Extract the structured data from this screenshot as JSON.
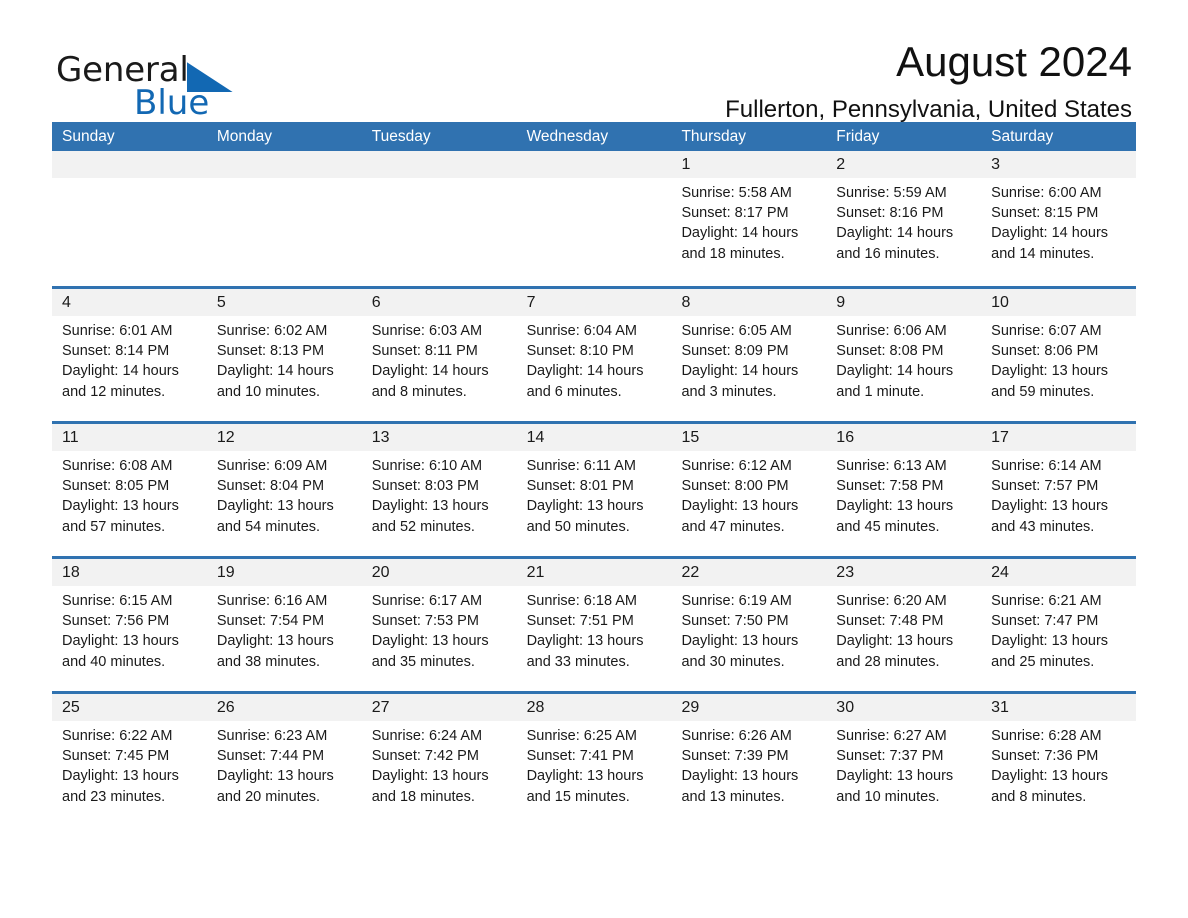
{
  "brand": {
    "name_part1": "General",
    "name_part2": "Blue",
    "accent_color": "#1268b3",
    "triangle_icon": "triangle-icon"
  },
  "header": {
    "title": "August 2024",
    "subtitle": "Fullerton, Pennsylvania, United States"
  },
  "theme": {
    "header_row_bg": "#3072b0",
    "header_row_text": "#ffffff",
    "daynum_band_bg": "#f2f2f2",
    "row_divider": "#3072b0",
    "body_text": "#1a1a1a",
    "page_bg": "#ffffff"
  },
  "calendar": {
    "weekday_headers": [
      "Sunday",
      "Monday",
      "Tuesday",
      "Wednesday",
      "Thursday",
      "Friday",
      "Saturday"
    ],
    "weeks": [
      {
        "days": [
          {
            "date": "",
            "sunrise": "",
            "sunset": "",
            "daylight_line1": "",
            "daylight_line2": ""
          },
          {
            "date": "",
            "sunrise": "",
            "sunset": "",
            "daylight_line1": "",
            "daylight_line2": ""
          },
          {
            "date": "",
            "sunrise": "",
            "sunset": "",
            "daylight_line1": "",
            "daylight_line2": ""
          },
          {
            "date": "",
            "sunrise": "",
            "sunset": "",
            "daylight_line1": "",
            "daylight_line2": ""
          },
          {
            "date": "1",
            "sunrise": "Sunrise: 5:58 AM",
            "sunset": "Sunset: 8:17 PM",
            "daylight_line1": "Daylight: 14 hours",
            "daylight_line2": "and 18 minutes."
          },
          {
            "date": "2",
            "sunrise": "Sunrise: 5:59 AM",
            "sunset": "Sunset: 8:16 PM",
            "daylight_line1": "Daylight: 14 hours",
            "daylight_line2": "and 16 minutes."
          },
          {
            "date": "3",
            "sunrise": "Sunrise: 6:00 AM",
            "sunset": "Sunset: 8:15 PM",
            "daylight_line1": "Daylight: 14 hours",
            "daylight_line2": "and 14 minutes."
          }
        ]
      },
      {
        "days": [
          {
            "date": "4",
            "sunrise": "Sunrise: 6:01 AM",
            "sunset": "Sunset: 8:14 PM",
            "daylight_line1": "Daylight: 14 hours",
            "daylight_line2": "and 12 minutes."
          },
          {
            "date": "5",
            "sunrise": "Sunrise: 6:02 AM",
            "sunset": "Sunset: 8:13 PM",
            "daylight_line1": "Daylight: 14 hours",
            "daylight_line2": "and 10 minutes."
          },
          {
            "date": "6",
            "sunrise": "Sunrise: 6:03 AM",
            "sunset": "Sunset: 8:11 PM",
            "daylight_line1": "Daylight: 14 hours",
            "daylight_line2": "and 8 minutes."
          },
          {
            "date": "7",
            "sunrise": "Sunrise: 6:04 AM",
            "sunset": "Sunset: 8:10 PM",
            "daylight_line1": "Daylight: 14 hours",
            "daylight_line2": "and 6 minutes."
          },
          {
            "date": "8",
            "sunrise": "Sunrise: 6:05 AM",
            "sunset": "Sunset: 8:09 PM",
            "daylight_line1": "Daylight: 14 hours",
            "daylight_line2": "and 3 minutes."
          },
          {
            "date": "9",
            "sunrise": "Sunrise: 6:06 AM",
            "sunset": "Sunset: 8:08 PM",
            "daylight_line1": "Daylight: 14 hours",
            "daylight_line2": "and 1 minute."
          },
          {
            "date": "10",
            "sunrise": "Sunrise: 6:07 AM",
            "sunset": "Sunset: 8:06 PM",
            "daylight_line1": "Daylight: 13 hours",
            "daylight_line2": "and 59 minutes."
          }
        ]
      },
      {
        "days": [
          {
            "date": "11",
            "sunrise": "Sunrise: 6:08 AM",
            "sunset": "Sunset: 8:05 PM",
            "daylight_line1": "Daylight: 13 hours",
            "daylight_line2": "and 57 minutes."
          },
          {
            "date": "12",
            "sunrise": "Sunrise: 6:09 AM",
            "sunset": "Sunset: 8:04 PM",
            "daylight_line1": "Daylight: 13 hours",
            "daylight_line2": "and 54 minutes."
          },
          {
            "date": "13",
            "sunrise": "Sunrise: 6:10 AM",
            "sunset": "Sunset: 8:03 PM",
            "daylight_line1": "Daylight: 13 hours",
            "daylight_line2": "and 52 minutes."
          },
          {
            "date": "14",
            "sunrise": "Sunrise: 6:11 AM",
            "sunset": "Sunset: 8:01 PM",
            "daylight_line1": "Daylight: 13 hours",
            "daylight_line2": "and 50 minutes."
          },
          {
            "date": "15",
            "sunrise": "Sunrise: 6:12 AM",
            "sunset": "Sunset: 8:00 PM",
            "daylight_line1": "Daylight: 13 hours",
            "daylight_line2": "and 47 minutes."
          },
          {
            "date": "16",
            "sunrise": "Sunrise: 6:13 AM",
            "sunset": "Sunset: 7:58 PM",
            "daylight_line1": "Daylight: 13 hours",
            "daylight_line2": "and 45 minutes."
          },
          {
            "date": "17",
            "sunrise": "Sunrise: 6:14 AM",
            "sunset": "Sunset: 7:57 PM",
            "daylight_line1": "Daylight: 13 hours",
            "daylight_line2": "and 43 minutes."
          }
        ]
      },
      {
        "days": [
          {
            "date": "18",
            "sunrise": "Sunrise: 6:15 AM",
            "sunset": "Sunset: 7:56 PM",
            "daylight_line1": "Daylight: 13 hours",
            "daylight_line2": "and 40 minutes."
          },
          {
            "date": "19",
            "sunrise": "Sunrise: 6:16 AM",
            "sunset": "Sunset: 7:54 PM",
            "daylight_line1": "Daylight: 13 hours",
            "daylight_line2": "and 38 minutes."
          },
          {
            "date": "20",
            "sunrise": "Sunrise: 6:17 AM",
            "sunset": "Sunset: 7:53 PM",
            "daylight_line1": "Daylight: 13 hours",
            "daylight_line2": "and 35 minutes."
          },
          {
            "date": "21",
            "sunrise": "Sunrise: 6:18 AM",
            "sunset": "Sunset: 7:51 PM",
            "daylight_line1": "Daylight: 13 hours",
            "daylight_line2": "and 33 minutes."
          },
          {
            "date": "22",
            "sunrise": "Sunrise: 6:19 AM",
            "sunset": "Sunset: 7:50 PM",
            "daylight_line1": "Daylight: 13 hours",
            "daylight_line2": "and 30 minutes."
          },
          {
            "date": "23",
            "sunrise": "Sunrise: 6:20 AM",
            "sunset": "Sunset: 7:48 PM",
            "daylight_line1": "Daylight: 13 hours",
            "daylight_line2": "and 28 minutes."
          },
          {
            "date": "24",
            "sunrise": "Sunrise: 6:21 AM",
            "sunset": "Sunset: 7:47 PM",
            "daylight_line1": "Daylight: 13 hours",
            "daylight_line2": "and 25 minutes."
          }
        ]
      },
      {
        "days": [
          {
            "date": "25",
            "sunrise": "Sunrise: 6:22 AM",
            "sunset": "Sunset: 7:45 PM",
            "daylight_line1": "Daylight: 13 hours",
            "daylight_line2": "and 23 minutes."
          },
          {
            "date": "26",
            "sunrise": "Sunrise: 6:23 AM",
            "sunset": "Sunset: 7:44 PM",
            "daylight_line1": "Daylight: 13 hours",
            "daylight_line2": "and 20 minutes."
          },
          {
            "date": "27",
            "sunrise": "Sunrise: 6:24 AM",
            "sunset": "Sunset: 7:42 PM",
            "daylight_line1": "Daylight: 13 hours",
            "daylight_line2": "and 18 minutes."
          },
          {
            "date": "28",
            "sunrise": "Sunrise: 6:25 AM",
            "sunset": "Sunset: 7:41 PM",
            "daylight_line1": "Daylight: 13 hours",
            "daylight_line2": "and 15 minutes."
          },
          {
            "date": "29",
            "sunrise": "Sunrise: 6:26 AM",
            "sunset": "Sunset: 7:39 PM",
            "daylight_line1": "Daylight: 13 hours",
            "daylight_line2": "and 13 minutes."
          },
          {
            "date": "30",
            "sunrise": "Sunrise: 6:27 AM",
            "sunset": "Sunset: 7:37 PM",
            "daylight_line1": "Daylight: 13 hours",
            "daylight_line2": "and 10 minutes."
          },
          {
            "date": "31",
            "sunrise": "Sunrise: 6:28 AM",
            "sunset": "Sunset: 7:36 PM",
            "daylight_line1": "Daylight: 13 hours",
            "daylight_line2": "and 8 minutes."
          }
        ]
      }
    ]
  }
}
